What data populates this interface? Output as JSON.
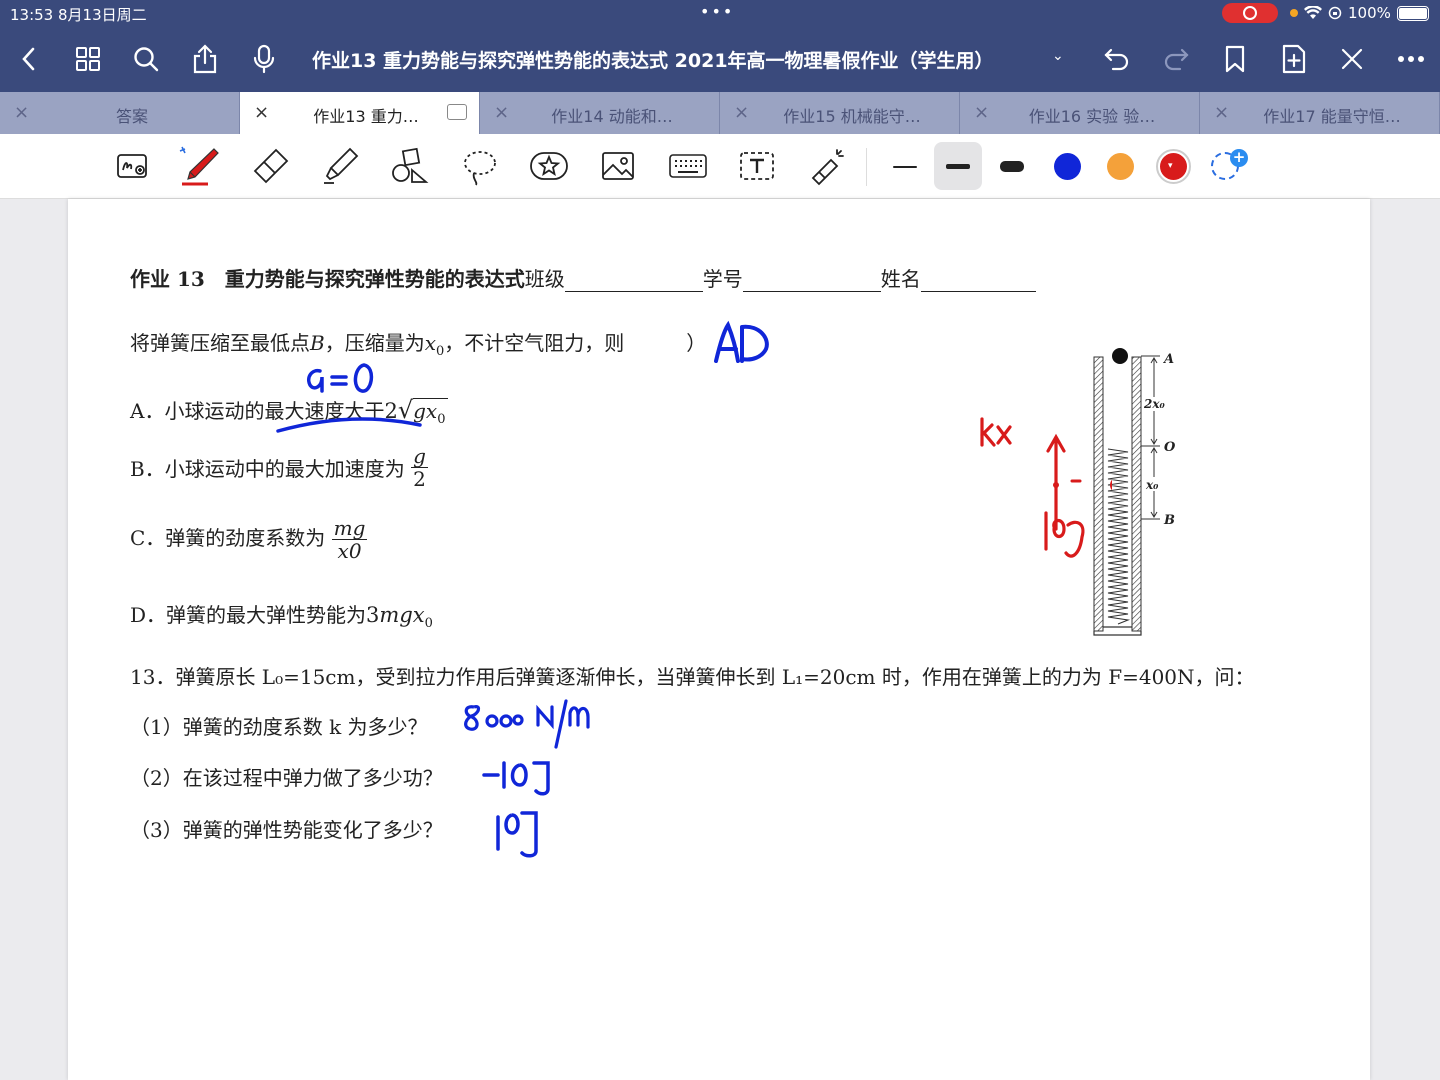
{
  "status": {
    "time": "13:53",
    "date": "8月13日周二",
    "battery": "100%"
  },
  "titlebar": {
    "title": "作业13  重力势能与探究弹性势能的表达式  2021年高一物理暑假作业（学生用）"
  },
  "tabs": [
    {
      "label": "答案",
      "active": false
    },
    {
      "label": "作业13  重力…",
      "active": true
    },
    {
      "label": "作业14  动能和…",
      "active": false
    },
    {
      "label": "作业15  机械能守…",
      "active": false
    },
    {
      "label": "作业16  实验 验…",
      "active": false
    },
    {
      "label": "作业17  能量守恒…",
      "active": false
    }
  ],
  "toolbar": {
    "colors": [
      "#1026d8",
      "#f4a13a",
      "#d81b1b"
    ],
    "selected_color": "#d81b1b",
    "tools": [
      "lasso-handwriting",
      "pen",
      "eraser",
      "highlighter",
      "shapes",
      "lasso",
      "sticker",
      "image",
      "keyboard",
      "text",
      "laser-pointer"
    ]
  },
  "document": {
    "heading": "作业 13　重力势能与探究弹性势能的表达式",
    "class_label": "班级",
    "id_label": "学号",
    "name_label": "姓名",
    "intro": "将弹簧压缩至最低点",
    "intro_b": "B",
    "intro_mid": "，压缩量为",
    "intro_tail": "，不计空气阻力，则",
    "intro_close": "）",
    "option_a": "A．小球运动的最大速度大于",
    "option_a_math": "2√gx₀",
    "option_b": "B．小球运动中的最大加速度为",
    "option_b_num": "g",
    "option_b_den": "2",
    "option_c": "C．弹簧的劲度系数为",
    "option_c_num": "mg",
    "option_c_den": "x0",
    "option_d": "D．弹簧的最大弹性势能为",
    "option_d_math": "3mgx₀",
    "q13": "13．弹簧原长 L₀=15cm，受到拉力作用后弹簧逐渐伸长，当弹簧伸长到 L₁=20cm 时，作用在弹簧上的力为 F=400N，问：",
    "q13_1": "（1）弹簧的劲度系数 k 为多少？",
    "q13_2": "（2）在该过程中弹力做了多少功？",
    "q13_3": "（3）弹簧的弹性势能变化了多少？",
    "figure": {
      "label_a": "A",
      "label_o": "O",
      "label_b": "B",
      "label_2x0": "2x₀",
      "label_x0": "x₀"
    }
  },
  "handwriting": {
    "answer": "AD",
    "note_a": "a=0",
    "kx": "kx",
    "mg": "mg",
    "ans1": "8000 N/m",
    "ans2": "-10J",
    "ans3": "10J"
  }
}
